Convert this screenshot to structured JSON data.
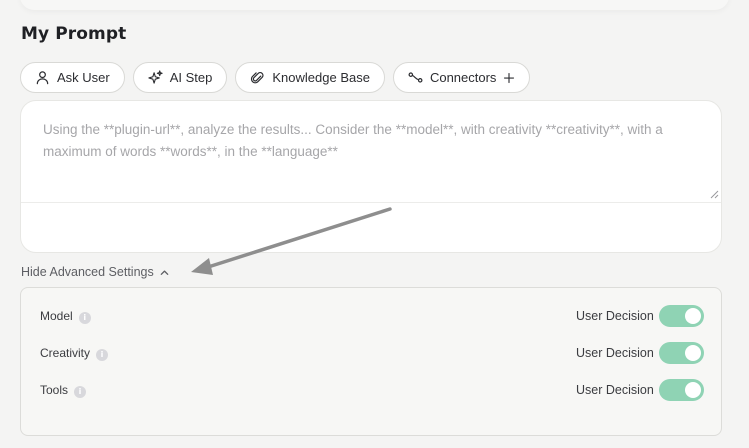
{
  "section": {
    "title": "My Prompt"
  },
  "toolbar": {
    "buttons": [
      {
        "label": "Ask User",
        "icon": "user-icon"
      },
      {
        "label": "AI Step",
        "icon": "sparkle-icon"
      },
      {
        "label": "Knowledge Base",
        "icon": "paperclip-icon"
      },
      {
        "label": "Connectors",
        "icon": "connectors-icon",
        "suffix_icon": "plus-icon"
      }
    ]
  },
  "prompt": {
    "placeholder": "Using the **plugin-url**, analyze the results... Consider the **model**, with creativity **creativity**, with a maximum of words **words**, in the **language**",
    "value": ""
  },
  "advanced": {
    "toggle_label": "Hide Advanced Settings",
    "expanded": true,
    "settings": [
      {
        "label": "Model",
        "decision": "User Decision",
        "enabled": true
      },
      {
        "label": "Creativity",
        "decision": "User Decision",
        "enabled": true
      },
      {
        "label": "Tools",
        "decision": "User Decision",
        "enabled": true
      }
    ]
  },
  "colors": {
    "toggle_on": "#8fd3b4",
    "arrow": "#8e8e8e",
    "placeholder": "#a6a6a9"
  }
}
